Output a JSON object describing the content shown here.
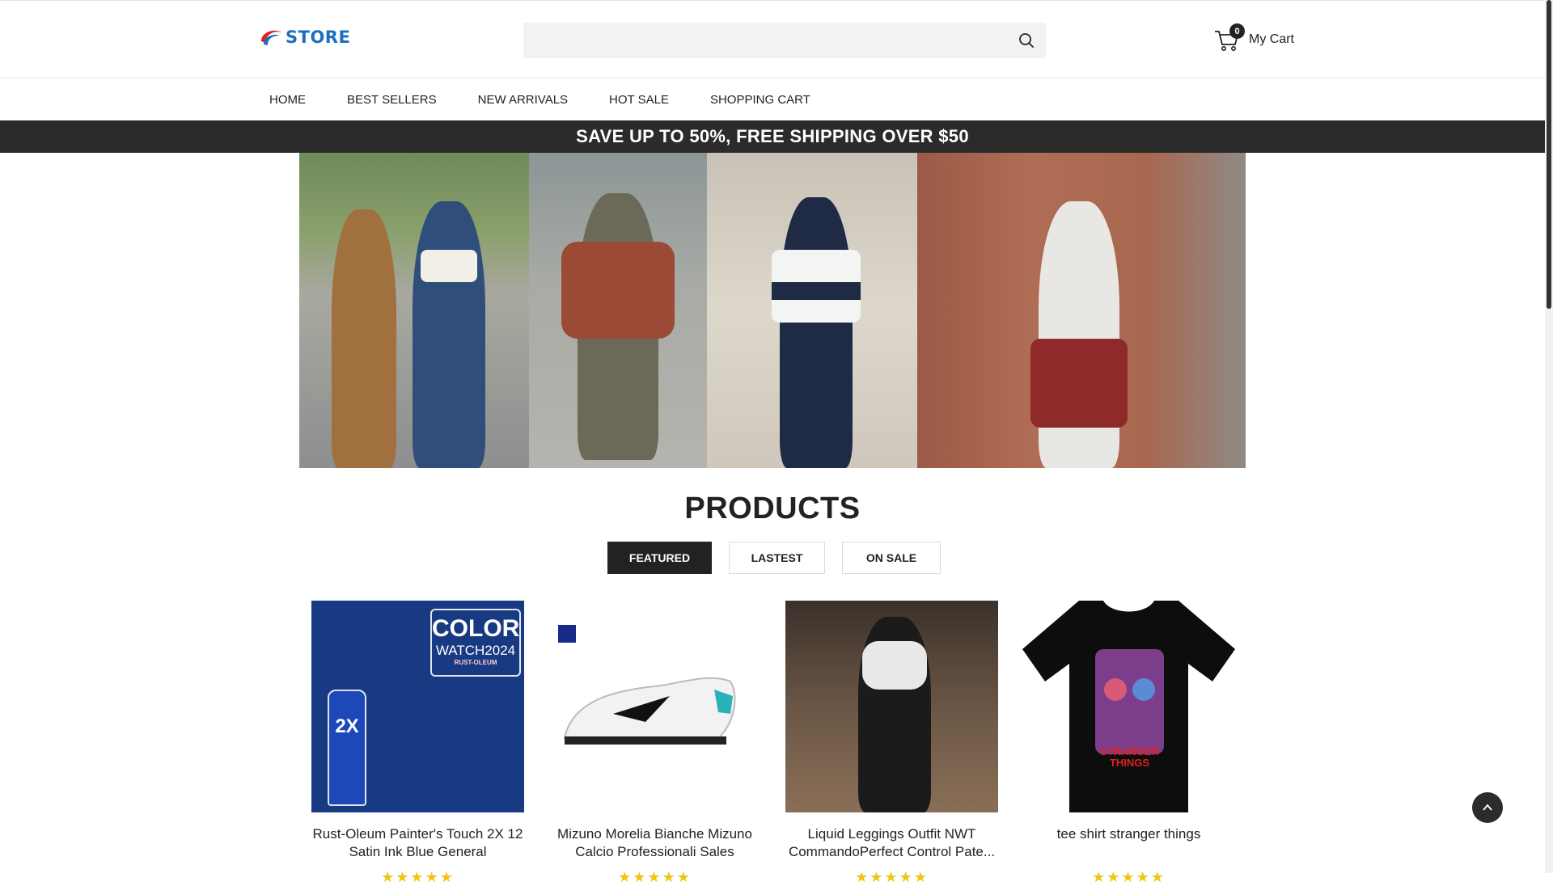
{
  "brand": {
    "logo_text": "STORE"
  },
  "search": {
    "placeholder": "",
    "value": ""
  },
  "cart": {
    "label": "My Cart",
    "count": "0"
  },
  "nav": {
    "items": [
      {
        "label": "HOME"
      },
      {
        "label": "BEST SELLERS"
      },
      {
        "label": "NEW ARRIVALS"
      },
      {
        "label": "HOT SALE"
      },
      {
        "label": "SHOPPING CART"
      }
    ]
  },
  "promo": {
    "text": "SAVE UP TO 50%, FREE SHIPPING OVER $50"
  },
  "products_section": {
    "title": "PRODUCTS",
    "tabs": [
      {
        "label": "FEATURED",
        "active": true
      },
      {
        "label": "LASTEST",
        "active": false
      },
      {
        "label": "ON SALE",
        "active": false
      }
    ]
  },
  "products": [
    {
      "name": "Rust-Oleum Painter's Touch 2X 12 Satin Ink Blue General",
      "rating": "★★★★★",
      "image_text": [
        "COLOR",
        "WATCH2024",
        "RUST-OLEUM",
        "2X"
      ]
    },
    {
      "name": "Mizuno Morelia Bianche Mizuno Calcio Professionali Sales",
      "rating": "★★★★★"
    },
    {
      "name": "Liquid Leggings Outfit NWT CommandoPerfect Control Pate...",
      "rating": "★★★★★"
    },
    {
      "name": "tee shirt stranger things",
      "rating": "★★★★★",
      "image_text": [
        "STRANGER",
        "THINGS"
      ]
    }
  ],
  "colors": {
    "accent": "#222222",
    "logo_blue": "#1b6ec2",
    "logo_red": "#e02020",
    "promo_bg": "#2b2b2b",
    "star": "#f1c40f"
  }
}
